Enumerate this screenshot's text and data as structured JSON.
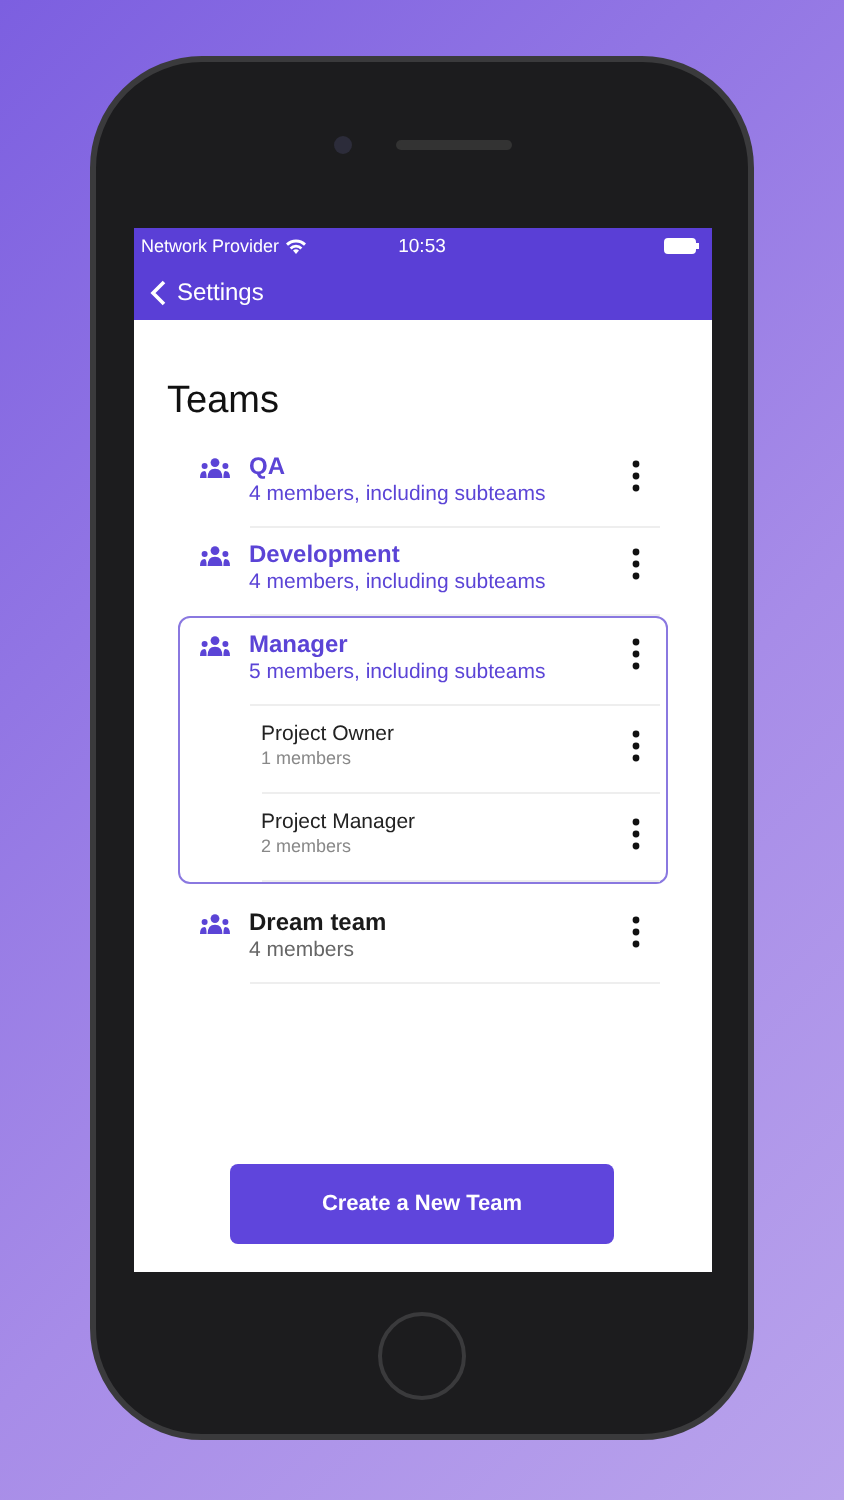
{
  "status_bar": {
    "carrier": "Network Provider",
    "time": "10:53"
  },
  "nav": {
    "back_label": "Settings"
  },
  "title": "Teams",
  "teams": [
    {
      "kind": "parent",
      "name": "QA",
      "subtitle": "4 members, including subteams",
      "expanded": false
    },
    {
      "kind": "parent",
      "name": "Development",
      "subtitle": "4 members, including subteams",
      "expanded": false
    },
    {
      "kind": "parent",
      "name": "Manager",
      "subtitle": "5 members, including subteams",
      "expanded": true,
      "children": [
        {
          "kind": "child",
          "name": "Project Owner",
          "subtitle": "1 members"
        },
        {
          "kind": "child",
          "name": "Project Manager",
          "subtitle": "2 members"
        }
      ]
    },
    {
      "kind": "single",
      "name": "Dream team",
      "subtitle": "4 members",
      "expanded": false
    }
  ],
  "create_button": "Create a New Team"
}
